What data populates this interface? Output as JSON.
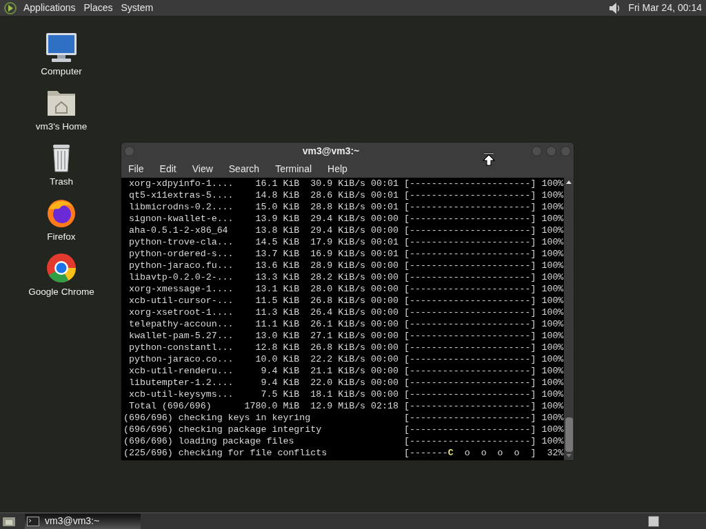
{
  "top_panel": {
    "menus": [
      "Applications",
      "Places",
      "System"
    ],
    "clock": "Fri Mar 24, 00:14"
  },
  "desktop_icons": [
    {
      "kind": "computer",
      "label": "Computer"
    },
    {
      "kind": "home",
      "label": "vm3's Home"
    },
    {
      "kind": "trash",
      "label": "Trash"
    },
    {
      "kind": "firefox",
      "label": "Firefox"
    },
    {
      "kind": "chrome",
      "label": "Google Chrome"
    }
  ],
  "window": {
    "title": "vm3@vm3:~",
    "menu": [
      "File",
      "Edit",
      "View",
      "Search",
      "Terminal",
      "Help"
    ],
    "lines": [
      {
        "kind": "download",
        "text": "xorg-xdpyinfo-1....    16.1 KiB  30.9 KiB/s 00:01 [----------------------] 100%"
      },
      {
        "kind": "download",
        "text": "qt5-x11extras-5....    14.8 KiB  28.6 KiB/s 00:01 [----------------------] 100%"
      },
      {
        "kind": "download",
        "text": "libmicrodns-0.2....    15.0 KiB  28.8 KiB/s 00:01 [----------------------] 100%"
      },
      {
        "kind": "download",
        "text": "signon-kwallet-e...    13.9 KiB  29.4 KiB/s 00:00 [----------------------] 100%"
      },
      {
        "kind": "download",
        "text": "aha-0.5.1-2-x86_64     13.8 KiB  29.4 KiB/s 00:00 [----------------------] 100%"
      },
      {
        "kind": "download",
        "text": "python-trove-cla...    14.5 KiB  17.9 KiB/s 00:01 [----------------------] 100%"
      },
      {
        "kind": "download",
        "text": "python-ordered-s...    13.7 KiB  16.9 KiB/s 00:01 [----------------------] 100%"
      },
      {
        "kind": "download",
        "text": "python-jaraco.fu...    13.6 KiB  28.9 KiB/s 00:00 [----------------------] 100%"
      },
      {
        "kind": "download",
        "text": "libavtp-0.2.0-2-...    13.3 KiB  28.2 KiB/s 00:00 [----------------------] 100%"
      },
      {
        "kind": "download",
        "text": "xorg-xmessage-1....    13.1 KiB  28.0 KiB/s 00:00 [----------------------] 100%"
      },
      {
        "kind": "download",
        "text": "xcb-util-cursor-...    11.5 KiB  26.8 KiB/s 00:00 [----------------------] 100%"
      },
      {
        "kind": "download",
        "text": "xorg-xsetroot-1....    11.3 KiB  26.4 KiB/s 00:00 [----------------------] 100%"
      },
      {
        "kind": "download",
        "text": "telepathy-accoun...    11.1 KiB  26.1 KiB/s 00:00 [----------------------] 100%"
      },
      {
        "kind": "download",
        "text": "kwallet-pam-5.27...    13.0 KiB  27.1 KiB/s 00:00 [----------------------] 100%"
      },
      {
        "kind": "download",
        "text": "python-constantl...    12.8 KiB  26.8 KiB/s 00:00 [----------------------] 100%"
      },
      {
        "kind": "download",
        "text": "python-jaraco.co...    10.0 KiB  22.2 KiB/s 00:00 [----------------------] 100%"
      },
      {
        "kind": "download",
        "text": "xcb-util-renderu...     9.4 KiB  21.1 KiB/s 00:00 [----------------------] 100%"
      },
      {
        "kind": "download",
        "text": "libutempter-1.2....     9.4 KiB  22.0 KiB/s 00:00 [----------------------] 100%"
      },
      {
        "kind": "download",
        "text": "xcb-util-keysyms...     7.5 KiB  18.1 KiB/s 00:00 [----------------------] 100%"
      },
      {
        "kind": "download",
        "text": "Total (696/696)      1780.0 MiB  12.9 MiB/s 02:18 [----------------------] 100%"
      },
      {
        "kind": "plain",
        "text": "(696/696) checking keys in keyring                 [----------------------] 100%"
      },
      {
        "kind": "plain",
        "text": "(696/696) checking package integrity               [----------------------] 100%"
      },
      {
        "kind": "plain",
        "text": "(696/696) loading package files                    [----------------------] 100%"
      },
      {
        "kind": "pacman",
        "before": "(225/696) checking for file conflicts              [-------",
        "head": "C",
        "after": "  o  o  o  o  ]  32%"
      }
    ]
  },
  "taskbar": {
    "items": [
      {
        "label": "vm3@vm3:~",
        "selected": true
      }
    ]
  }
}
